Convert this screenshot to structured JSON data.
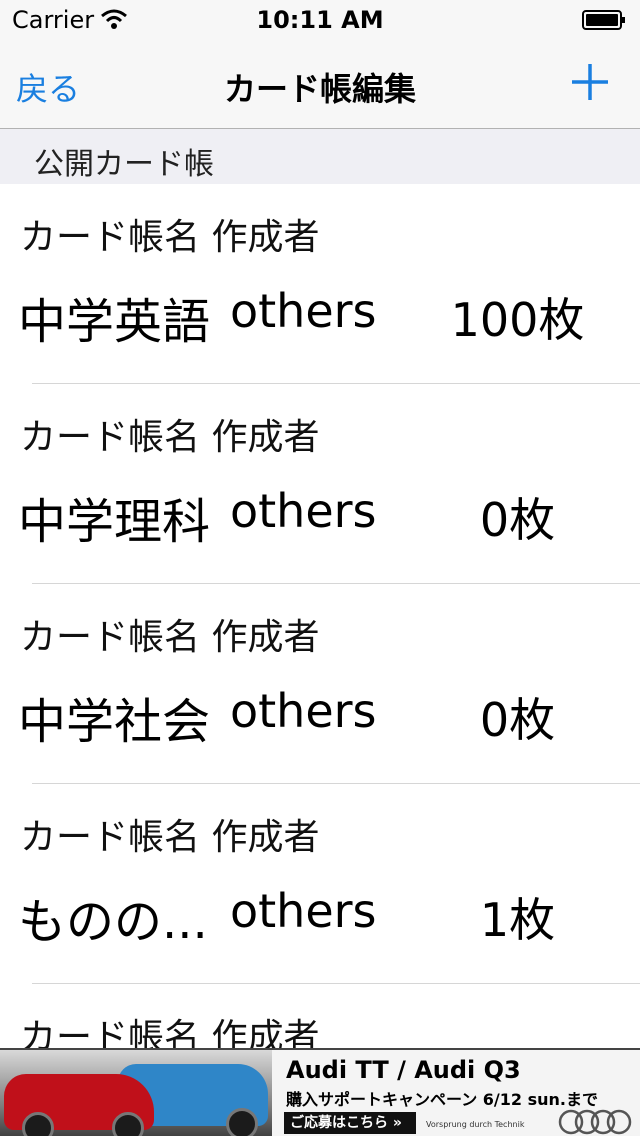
{
  "status_bar": {
    "carrier": "Carrier",
    "time": "10:11 AM"
  },
  "nav": {
    "back_label": "戻る",
    "title": "カード帳編集",
    "add_icon": "plus-icon"
  },
  "section": {
    "title": "公開カード帳"
  },
  "list": {
    "items": [
      {
        "label": "カード帳名 作成者",
        "name": "中学英語",
        "owner": "others",
        "count": "100枚"
      },
      {
        "label": "カード帳名 作成者",
        "name": "中学理科",
        "owner": "others",
        "count": "0枚"
      },
      {
        "label": "カード帳名 作成者",
        "name": "中学社会",
        "owner": "others",
        "count": "0枚"
      },
      {
        "label": "カード帳名 作成者",
        "name": "ものの...",
        "owner": "others",
        "count": "1枚"
      },
      {
        "label": "カード帳名 作成者",
        "name": "",
        "owner": "",
        "count": ""
      }
    ]
  },
  "ad": {
    "title": "Audi TT / Audi Q3",
    "subtitle": "購入サポートキャンペーン 6/12 sun.まで",
    "cta": "ご応募はこちら »",
    "tagline": "Vorsprung durch Technik"
  },
  "colors": {
    "accent": "#1a7fe0",
    "bar_bg": "#f7f7f7",
    "section_bg": "#efeff4"
  }
}
